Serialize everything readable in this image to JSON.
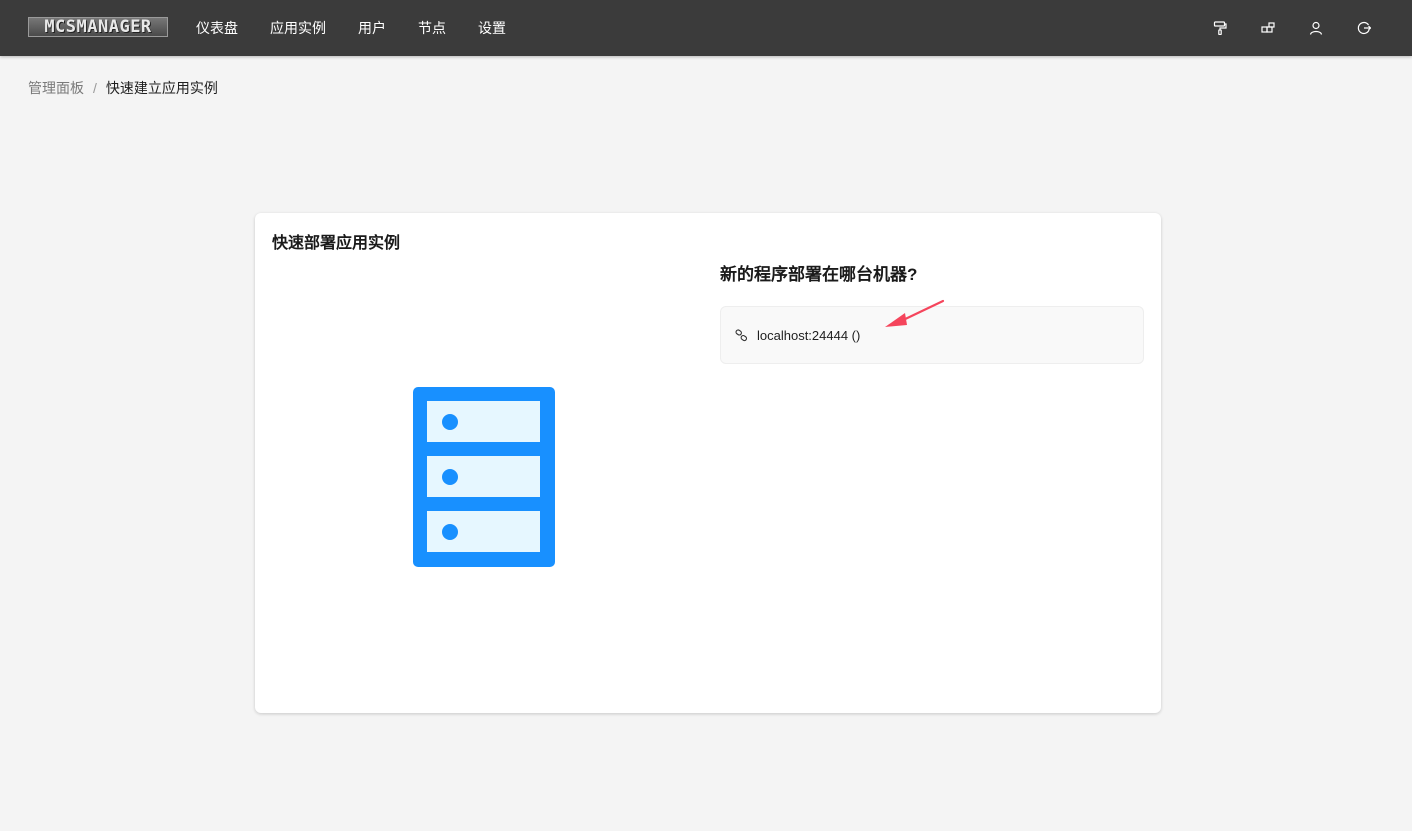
{
  "app": {
    "logo_text": "MCSMANAGER"
  },
  "nav": {
    "items": [
      {
        "label": "仪表盘"
      },
      {
        "label": "应用实例"
      },
      {
        "label": "用户"
      },
      {
        "label": "节点"
      },
      {
        "label": "设置"
      }
    ]
  },
  "top_icons": [
    "paint-roller-icon",
    "blocks-icon",
    "user-icon",
    "logout-icon"
  ],
  "breadcrumb": {
    "root": "管理面板",
    "separator": "/",
    "current": "快速建立应用实例"
  },
  "card": {
    "title": "快速部署应用实例",
    "question": "新的程序部署在哪台机器?",
    "node_option": {
      "label": "localhost:24444 ()",
      "icon": "link-icon"
    }
  },
  "colors": {
    "topbar": "#3b3b3b",
    "accent_blue": "#1890ff",
    "server_fill": "#e6f7ff",
    "arrow": "#f5455c"
  }
}
